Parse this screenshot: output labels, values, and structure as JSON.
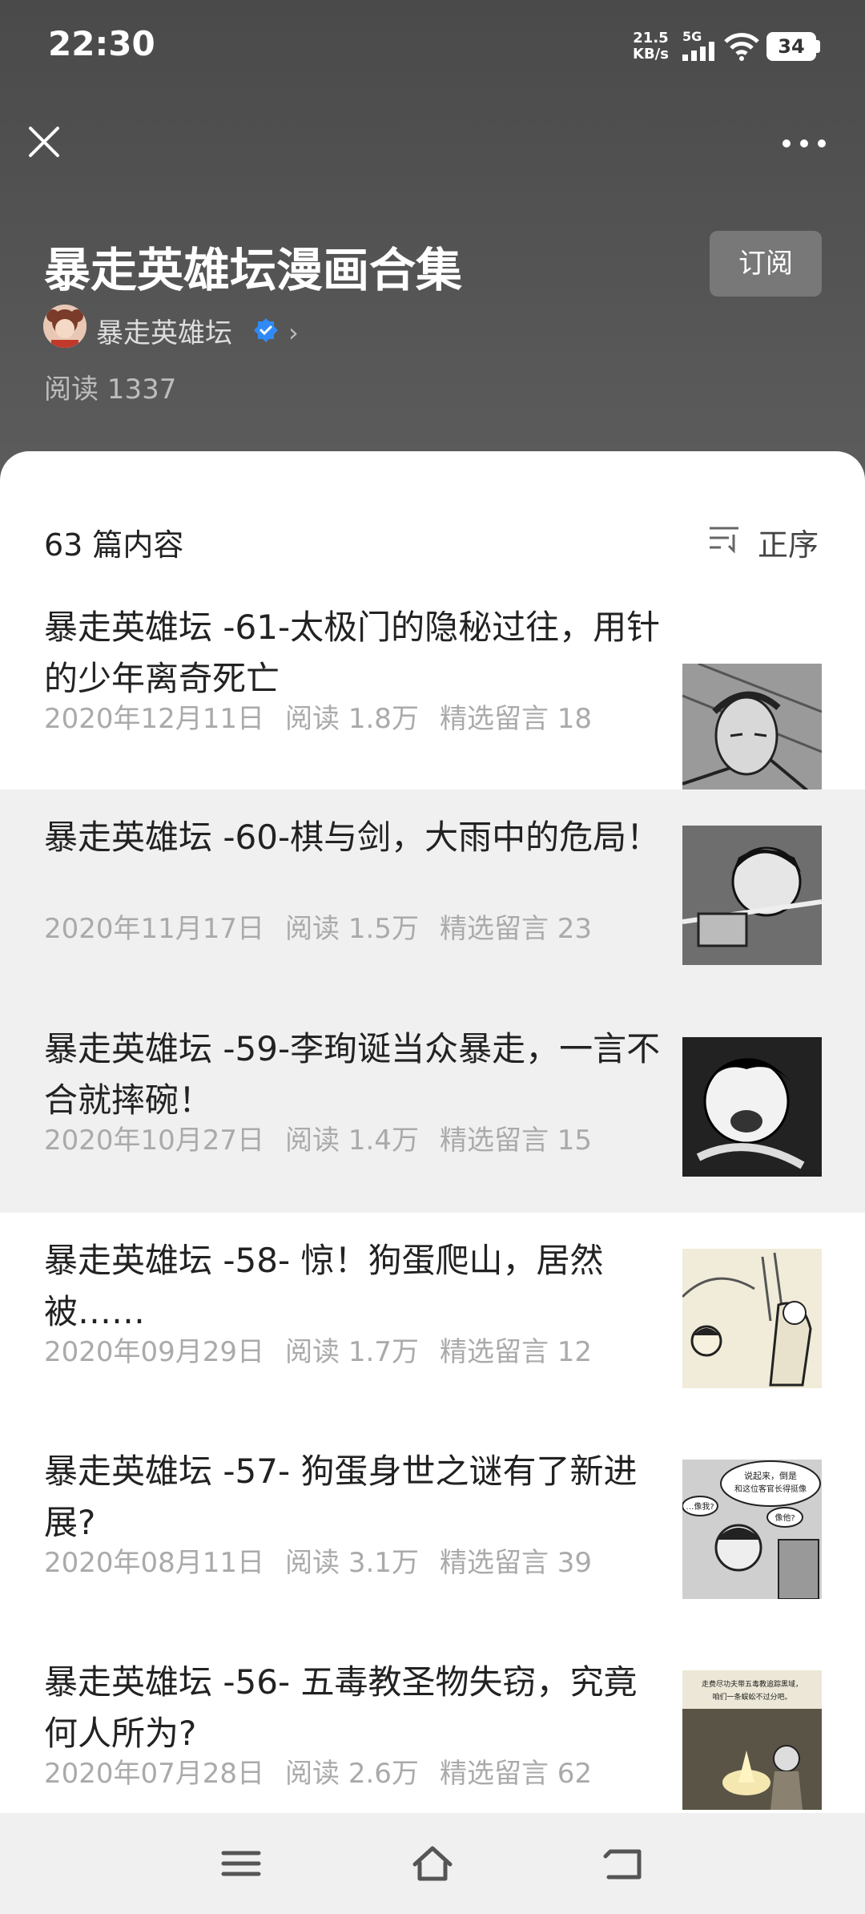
{
  "status": {
    "time": "22:30",
    "speed": "21.5",
    "speed_unit": "KB/s",
    "network": "5G",
    "battery": "34"
  },
  "header": {
    "title": "暴走英雄坛漫画合集",
    "subscribe_label": "订阅",
    "author": "暴走英雄坛",
    "reads": "阅读 1337"
  },
  "list": {
    "count_label": "63 篇内容",
    "sort_label": "正序",
    "items": [
      {
        "title": "暴走英雄坛 -61-太极门的隐秘过往，用针的少年离奇死亡",
        "date": "2020年12月11日",
        "reads": "阅读 1.8万",
        "comments": "精选留言 18"
      },
      {
        "title": "暴走英雄坛 -60-棋与剑，大雨中的危局！",
        "date": "2020年11月17日",
        "reads": "阅读 1.5万",
        "comments": "精选留言 23"
      },
      {
        "title": "暴走英雄坛 -59-李珣诞当众暴走，一言不合就摔碗！",
        "date": "2020年10月27日",
        "reads": "阅读 1.4万",
        "comments": "精选留言 15"
      },
      {
        "title": "暴走英雄坛 -58- 惊！狗蛋爬山，居然被……",
        "date": "2020年09月29日",
        "reads": "阅读 1.7万",
        "comments": "精选留言 12"
      },
      {
        "title": "暴走英雄坛 -57- 狗蛋身世之谜有了新进展?",
        "date": "2020年08月11日",
        "reads": "阅读 3.1万",
        "comments": "精选留言 39"
      },
      {
        "title": "暴走英雄坛 -56- 五毒教圣物失窃，究竟何人所为?",
        "date": "2020年07月28日",
        "reads": "阅读 2.6万",
        "comments": "精选留言 62"
      }
    ]
  },
  "thumb_texts": {
    "t57a": "说起来，倒是",
    "t57b": "和这位客官长得挺像",
    "t57c": "…像我?",
    "t57d": "像他?",
    "t56a": "走费尽功夫带五毒教追踪黑域，",
    "t56b": "咱们一条蜈蚣不过分吧。"
  },
  "colors": {
    "header_bg": "#555555",
    "accent_verified": "#2f8af5",
    "meta_text": "#aaaaaa",
    "highlight_row": "#f0f0f0"
  }
}
